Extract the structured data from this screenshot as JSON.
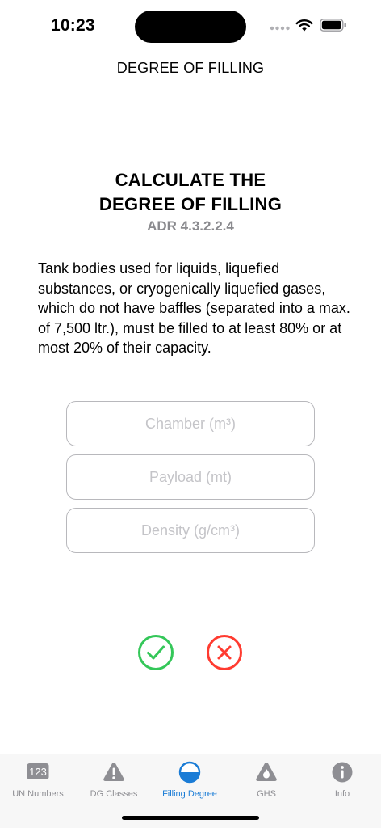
{
  "status": {
    "time": "10:23"
  },
  "nav": {
    "title": "DEGREE OF FILLING"
  },
  "content": {
    "heading_line1": "CALCULATE THE",
    "heading_line2": "DEGREE OF FILLING",
    "subheading": "ADR 4.3.2.2.4",
    "description": "Tank bodies used for liquids, liquefied substances, or cryogenically liquefied gases, which do not have baffles (separated into a max. of 7,500 ltr.), must be filled to at least 80% or at most 20% of their capacity."
  },
  "form": {
    "chamber": {
      "value": "",
      "placeholder": "Chamber (m³)"
    },
    "payload": {
      "value": "",
      "placeholder": "Payload (mt)"
    },
    "density": {
      "value": "",
      "placeholder": "Density (g/cm³)"
    }
  },
  "actions": {
    "confirm_icon": "checkmark-circle-icon",
    "clear_icon": "x-circle-icon"
  },
  "tabbar": {
    "active": "Filling Degree",
    "items": [
      {
        "label": "UN Numbers",
        "icon": "un-numbers-icon",
        "badge": "123"
      },
      {
        "label": "DG Classes",
        "icon": "warning-triangle-icon"
      },
      {
        "label": "Filling Degree",
        "icon": "half-filled-circle-icon"
      },
      {
        "label": "GHS",
        "icon": "flame-triangle-icon"
      },
      {
        "label": "Info",
        "icon": "info-icon"
      }
    ]
  },
  "colors": {
    "accent": "#1a7cd6",
    "confirm": "#34c759",
    "clear": "#ff3b30",
    "muted": "#8e8e93"
  }
}
